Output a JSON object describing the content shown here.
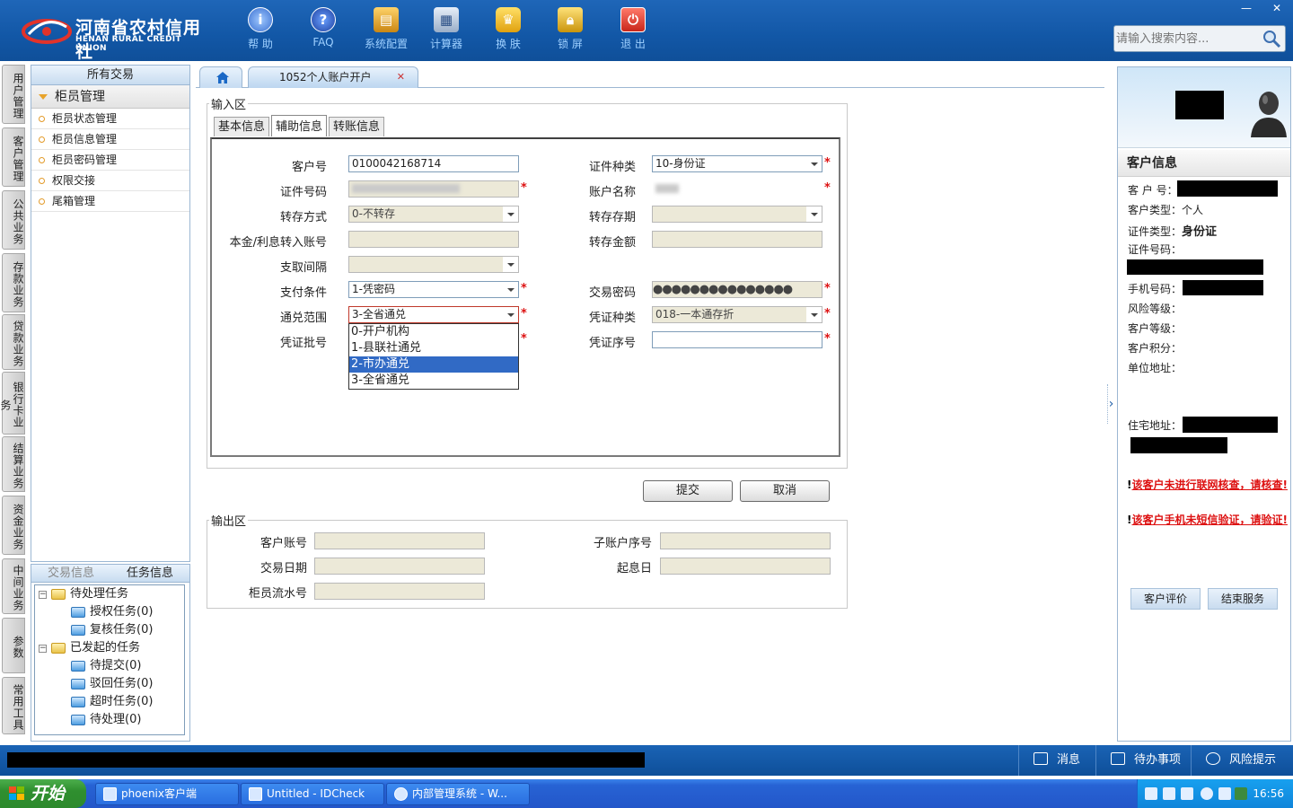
{
  "header": {
    "logo_cn": "河南省农村信用社",
    "logo_en": "HENAN RURAL CREDIT UNION",
    "tools": [
      {
        "label": "帮 助",
        "icon": "info-icon"
      },
      {
        "label": "FAQ",
        "icon": "question-icon"
      },
      {
        "label": "系统配置",
        "icon": "toolbox-icon"
      },
      {
        "label": "计算器",
        "icon": "calculator-icon"
      },
      {
        "label": "换 肤",
        "icon": "shirt-icon"
      },
      {
        "label": "锁 屏",
        "icon": "lock-icon"
      },
      {
        "label": "退 出",
        "icon": "power-icon"
      }
    ],
    "search_placeholder": "请输入搜索内容...",
    "window_min": "—",
    "window_close": "✕"
  },
  "vnav": [
    "用户管理",
    "客户管理",
    "公共业务",
    "存款业务",
    "贷款业务",
    "银行卡业务",
    "结算业务",
    "资金业务",
    "中间业务",
    "参数",
    "常用工具"
  ],
  "menu": {
    "header": "所有交易",
    "group": "柜员管理",
    "items": [
      "柜员状态管理",
      "柜员信息管理",
      "柜员密码管理",
      "权限交接",
      "尾箱管理"
    ]
  },
  "tasks": {
    "tabs": [
      "交易信息",
      "任务信息"
    ],
    "tree": [
      {
        "label": "待处理任务",
        "level": 0
      },
      {
        "label": "授权任务(0)",
        "level": 1
      },
      {
        "label": "复核任务(0)",
        "level": 1
      },
      {
        "label": "已发起的任务",
        "level": 0
      },
      {
        "label": "待提交(0)",
        "level": 1
      },
      {
        "label": "驳回任务(0)",
        "level": 1
      },
      {
        "label": "超时任务(0)",
        "level": 1
      },
      {
        "label": "待处理(0)",
        "level": 1
      }
    ]
  },
  "tabs": {
    "home_icon": "home-icon",
    "active": "1052个人账户开户",
    "close": "✕"
  },
  "input_area": {
    "legend": "输入区",
    "subtabs": [
      "基本信息",
      "辅助信息",
      "转账信息"
    ],
    "fields": {
      "customer_no_label": "客户号",
      "customer_no": "0100042168714",
      "id_type_label": "证件种类",
      "id_type": "10-身份证",
      "id_no_label": "证件号码",
      "account_name_label": "账户名称",
      "transfer_mode_label": "转存方式",
      "transfer_mode": "0-不转存",
      "transfer_term_label": "转存存期",
      "interest_account_label": "本金/利息转入账号",
      "transfer_amount_label": "转存金额",
      "withdraw_interval_label": "支取间隔",
      "pay_condition_label": "支付条件",
      "pay_condition": "1-凭密码",
      "trade_password_label": "交易密码",
      "trade_password": "●●●●●●●●●●●●●●●",
      "exchange_scope_label": "通兑范围",
      "exchange_scope": "3-全省通兑",
      "voucher_type_label": "凭证种类",
      "voucher_type": "018-一本通存折",
      "voucher_batch_label": "凭证批号",
      "voucher_seq_label": "凭证序号"
    },
    "dropdown_options": [
      "0-开户机构",
      "1-县联社通兑",
      "2-市办通兑",
      "3-全省通兑"
    ]
  },
  "buttons": {
    "submit": "提交",
    "cancel": "取消"
  },
  "output_area": {
    "legend": "输出区",
    "customer_account_label": "客户账号",
    "sub_account_label": "子账户序号",
    "trade_date_label": "交易日期",
    "value_date_label": "起息日",
    "teller_serial_label": "柜员流水号"
  },
  "customer_info": {
    "title": "客户信息",
    "customer_no_label": "客 户 号：",
    "customer_type_label": "客户类型：",
    "customer_type": "个人",
    "id_type_label": "证件类型：",
    "id_type": "身份证",
    "id_no_label": "证件号码：",
    "phone_label": "手机号码：",
    "risk_level_label": "风险等级：",
    "customer_level_label": "客户等级：",
    "customer_points_label": "客户积分：",
    "company_address_label": "单位地址：",
    "home_address_label": "住宅地址：",
    "warning1": "该客户未进行联网核查，请核查!",
    "warning2": "该客户手机未短信验证，请验证!",
    "evaluate_button": "客户评价",
    "end_service_button": "结束服务"
  },
  "statusbar": {
    "messages": "消息",
    "todo": "待办事项",
    "risk": "风险提示"
  },
  "taskbar": {
    "start": "开始",
    "items": [
      "phoenix客户端",
      "Untitled - IDCheck",
      "内部管理系统 - W..."
    ],
    "clock": "16:56"
  },
  "colors": {
    "header_blue": "#1257a6",
    "select_blue": "#316ac5",
    "required_red": "#d11111"
  }
}
